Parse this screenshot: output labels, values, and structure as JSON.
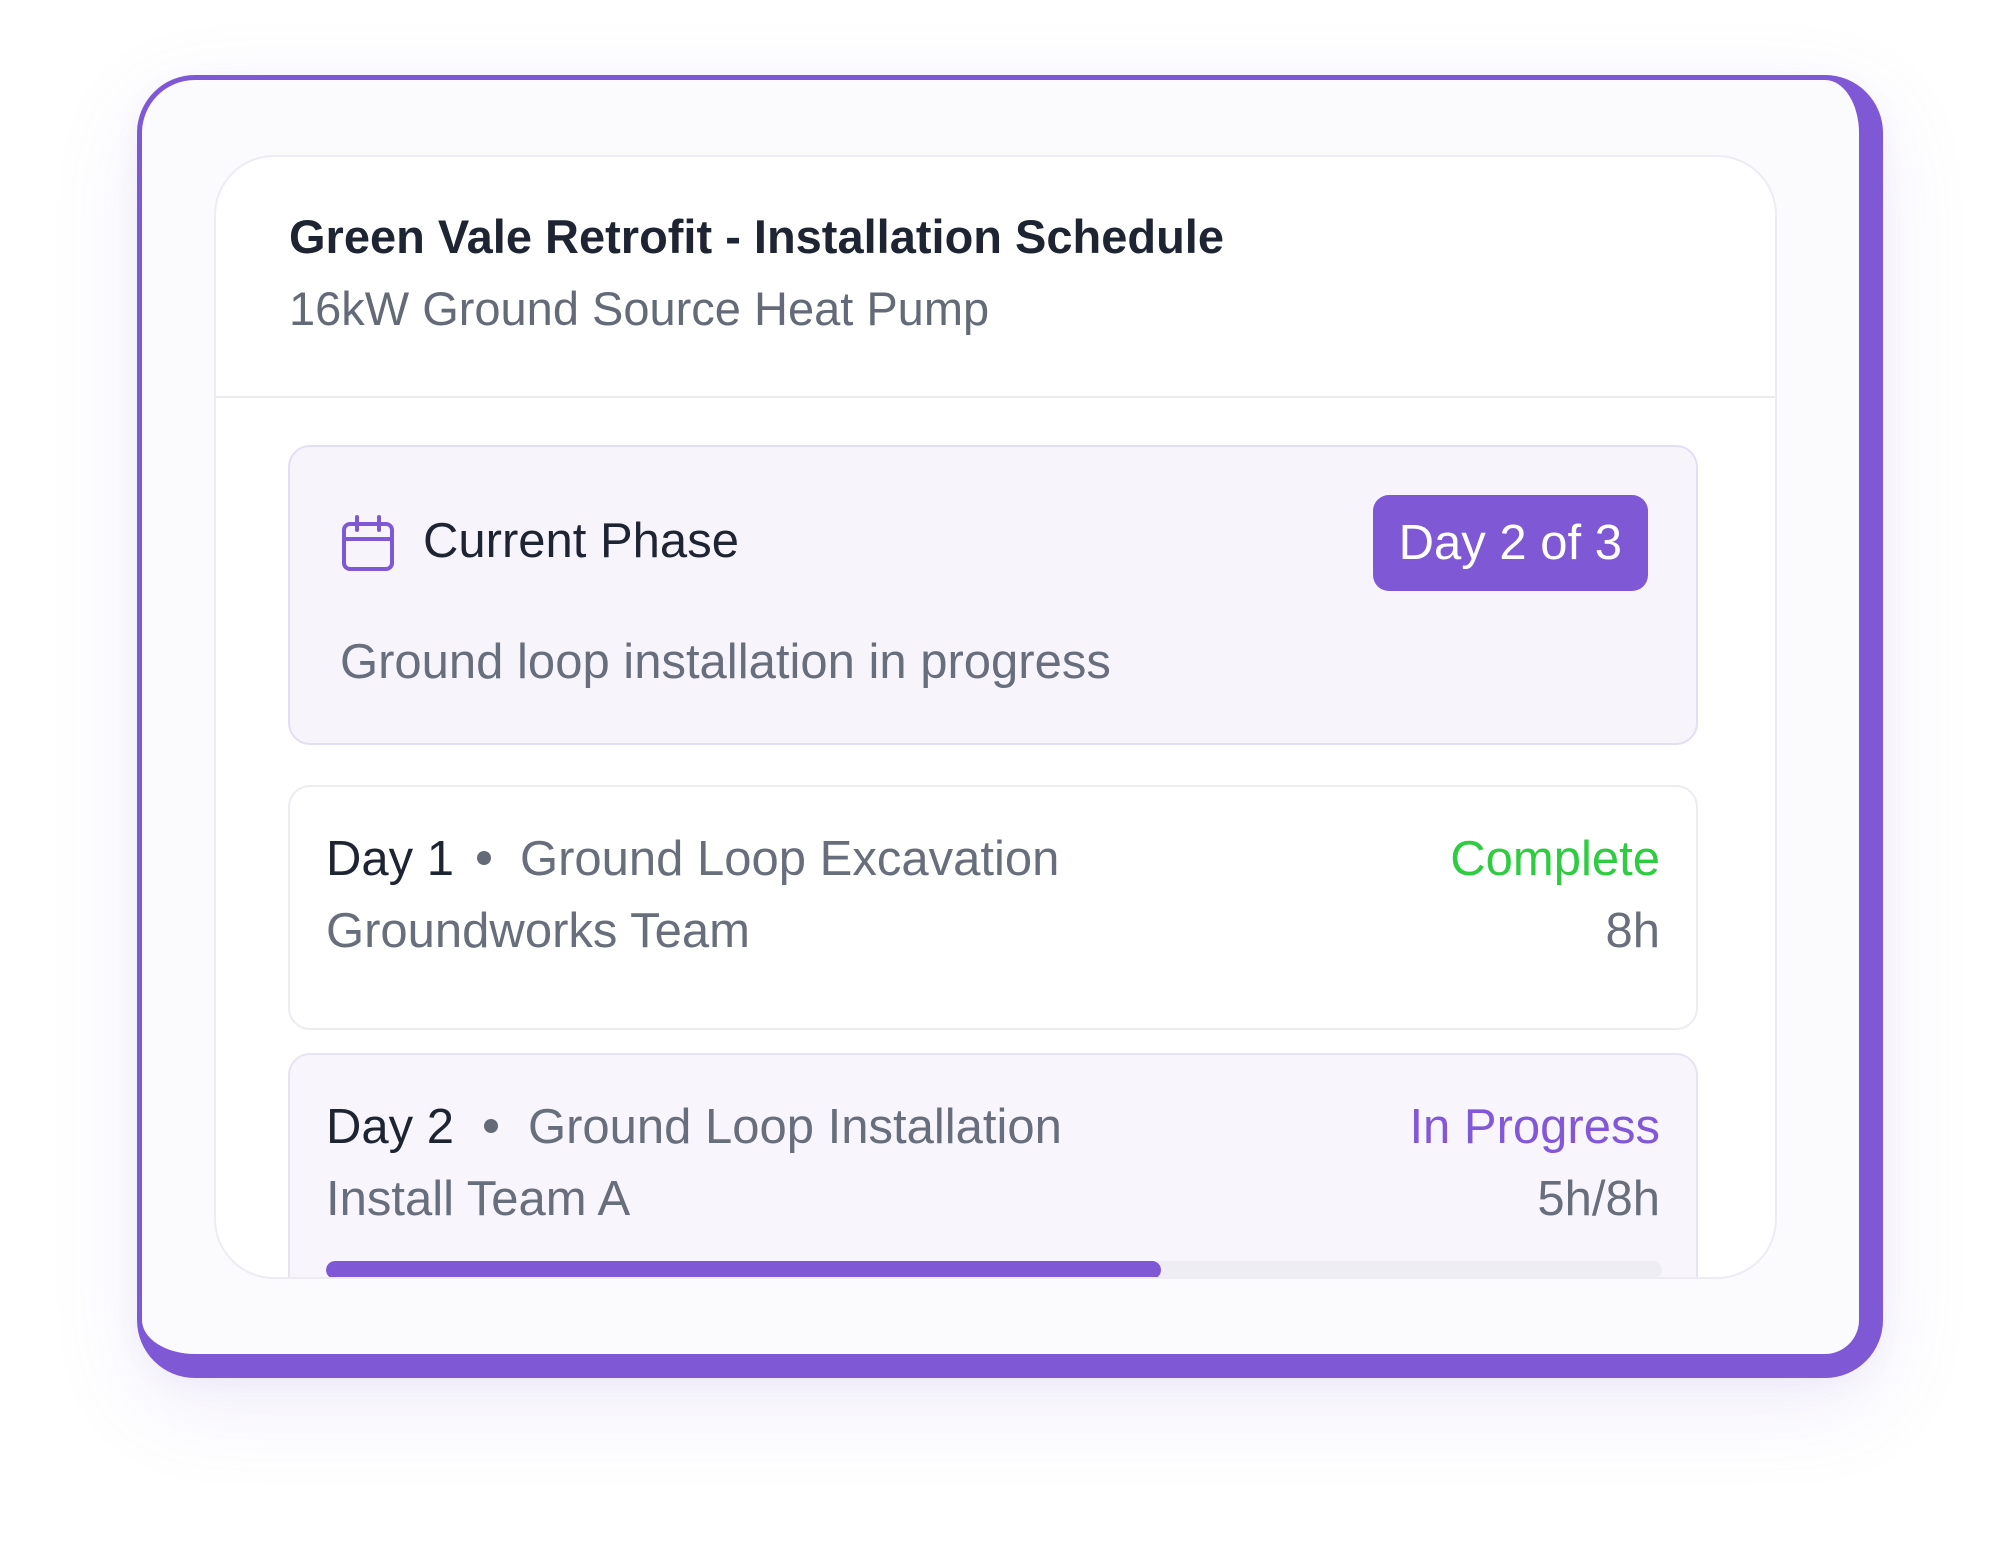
{
  "header": {
    "title": "Green Vale Retrofit - Installation Schedule",
    "subtitle": "16kW Ground Source Heat Pump"
  },
  "phase": {
    "icon": "calendar-icon",
    "label": "Current Phase",
    "badge": "Day 2 of 3",
    "description": "Ground loop installation in progress"
  },
  "tasks": [
    {
      "day": "Day 1",
      "name": "Ground Loop Excavation",
      "team": "Groundworks Team",
      "status": "Complete",
      "status_color": "#2ecc40",
      "hours": "8h"
    },
    {
      "day": "Day 2",
      "name": "Ground Loop Installation",
      "team": "Install Team A",
      "status": "In Progress",
      "status_color": "#8257d8",
      "hours": "5h/8h",
      "progress": 0.625
    }
  ],
  "colors": {
    "accent": "#7f58d6",
    "complete": "#2ecc40"
  }
}
